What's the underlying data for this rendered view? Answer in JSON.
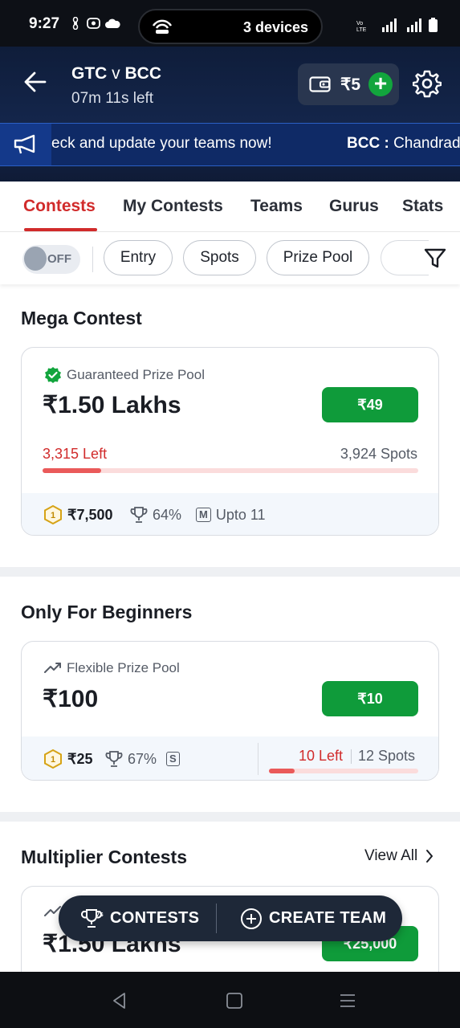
{
  "status_bar": {
    "time": "9:27",
    "devices_text": "3 devices"
  },
  "header": {
    "team1": "GTC",
    "vs": "v",
    "team2": "BCC",
    "time_left": "07m 11s left",
    "wallet_amount": "₹5",
    "add_symbol": "+"
  },
  "ticker": {
    "text": "eck and update your teams now!",
    "team": "BCC",
    "separator": " : ",
    "player": "Chandrade"
  },
  "tabs": [
    {
      "label": "Contests",
      "active": true
    },
    {
      "label": "My Contests",
      "active": false
    },
    {
      "label": "Teams",
      "active": false
    },
    {
      "label": "Gurus",
      "active": false
    },
    {
      "label": "Stats",
      "active": false
    }
  ],
  "filters": {
    "toggle_label": "OFF",
    "chips": [
      "Entry",
      "Spots",
      "Prize Pool"
    ]
  },
  "mega": {
    "section_title": "Mega Contest",
    "pool_type": "Guaranteed Prize Pool",
    "prize": "₹1.50 Lakhs",
    "entry": "₹49",
    "spots_left": "3,315 Left",
    "spots_total": "3,924 Spots",
    "fill_fraction": 0.155,
    "first_prize": "₹7,500",
    "win_percent": "64%",
    "max_teams_badge": "M",
    "max_teams": "Upto 11"
  },
  "beginners": {
    "section_title": "Only For Beginners",
    "pool_type": "Flexible Prize Pool",
    "prize": "₹100",
    "entry": "₹10",
    "first_prize": "₹25",
    "win_percent": "67%",
    "single_badge": "S",
    "spots_left": "10 Left",
    "spots_total": "12 Spots",
    "fill_fraction": 0.17
  },
  "multiplier": {
    "section_title": "Multiplier Contests",
    "view_all": "View All",
    "prize": "₹1.50 Lakhs",
    "entry": "₹25,000"
  },
  "floating_bar": {
    "contests_label": "CONTESTS",
    "create_team_label": "CREATE TEAM"
  },
  "colors": {
    "accent_red": "#d12b2b",
    "join_green": "#0f9b3a",
    "header_navy": "#14264c"
  }
}
